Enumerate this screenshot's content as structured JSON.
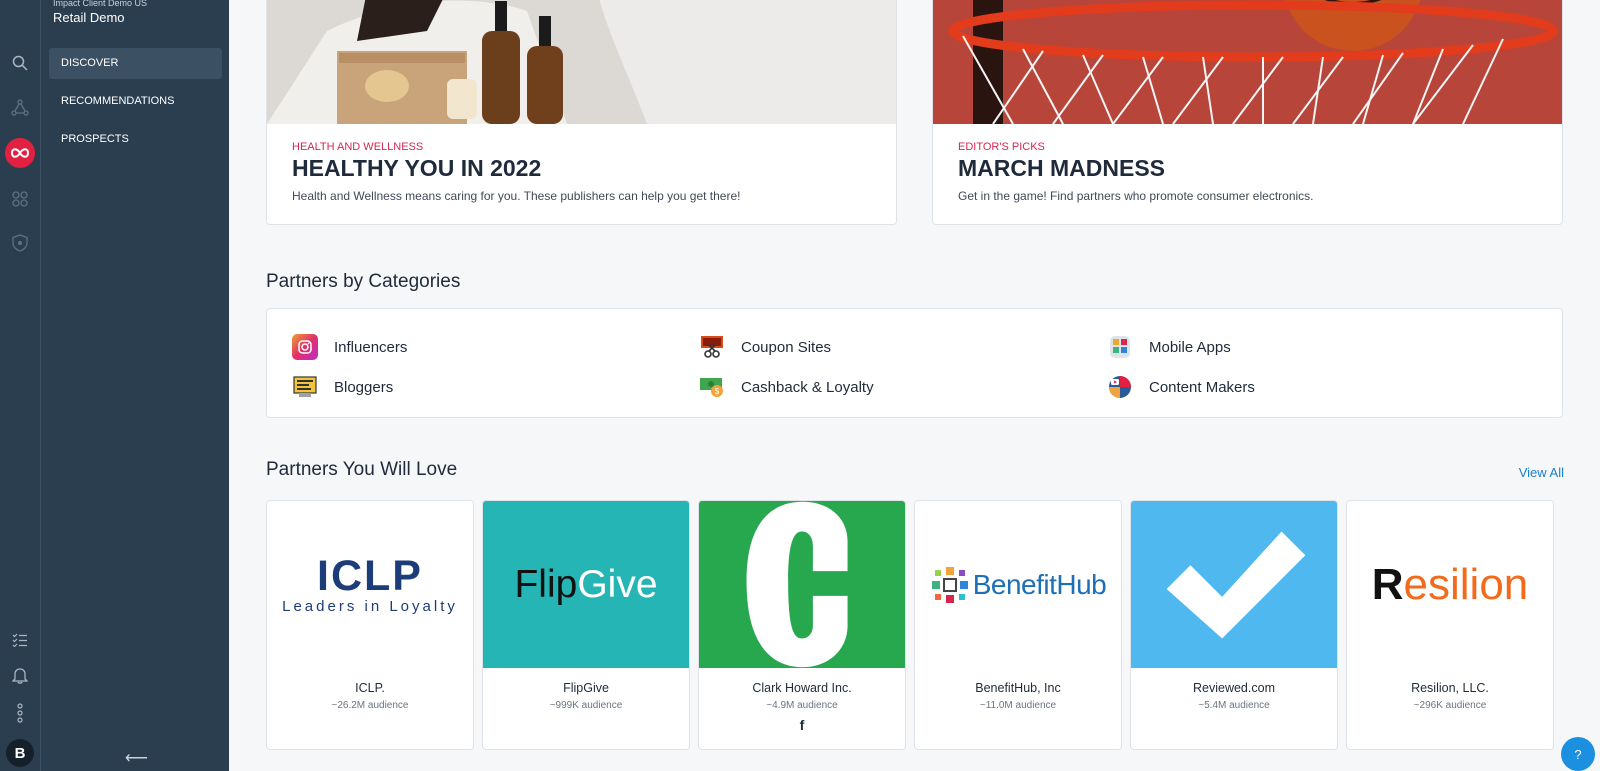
{
  "sidebar": {
    "client_sub": "Impact Client Demo US",
    "client_name": "Retail Demo",
    "nav": [
      "DISCOVER",
      "RECOMMENDATIONS",
      "PROSPECTS"
    ],
    "avatar_letter": "B",
    "collapse_glyph": "⟵"
  },
  "features": [
    {
      "kicker": "HEALTH AND WELLNESS",
      "title": "HEALTHY YOU IN 2022",
      "desc": "Health and Wellness means caring for you. These publishers can help you get there!"
    },
    {
      "kicker": "EDITOR'S PICKS",
      "title": "MARCH MADNESS",
      "desc": "Get in the game! Find partners who promote consumer electronics."
    }
  ],
  "categories_section": {
    "title": "Partners by Categories",
    "items": [
      "Influencers",
      "Coupon Sites",
      "Mobile Apps",
      "Bloggers",
      "Cashback & Loyalty",
      "Content Makers"
    ]
  },
  "partners_section": {
    "title": "Partners You Will Love",
    "view_all": "View All",
    "partners": [
      {
        "name": "ICLP.",
        "audience": "~26.2M audience",
        "logo_main": "ICLP",
        "logo_sub": "Leaders in Loyalty"
      },
      {
        "name": "FlipGive",
        "audience": "~999K audience",
        "logo_a": "Flip",
        "logo_b": "Give"
      },
      {
        "name": "Clark Howard Inc.",
        "audience": "~4.9M audience",
        "social": "f"
      },
      {
        "name": "BenefitHub, Inc",
        "audience": "~11.0M audience",
        "logo_text": "BenefitHub"
      },
      {
        "name": "Reviewed.com",
        "audience": "~5.4M audience"
      },
      {
        "name": "Resilion, LLC.",
        "audience": "~296K audience",
        "logo_r": "R",
        "logo_rest": "esilion"
      }
    ]
  },
  "help_label": "?",
  "colors": {
    "sidebar_bg": "#2b3e50",
    "accent_link": "#1b7fcd",
    "kicker": "#d6264e",
    "flipgive_bg": "#26b5b5",
    "clark_bg": "#27a84f",
    "reviewed_bg": "#4fb8ef"
  }
}
